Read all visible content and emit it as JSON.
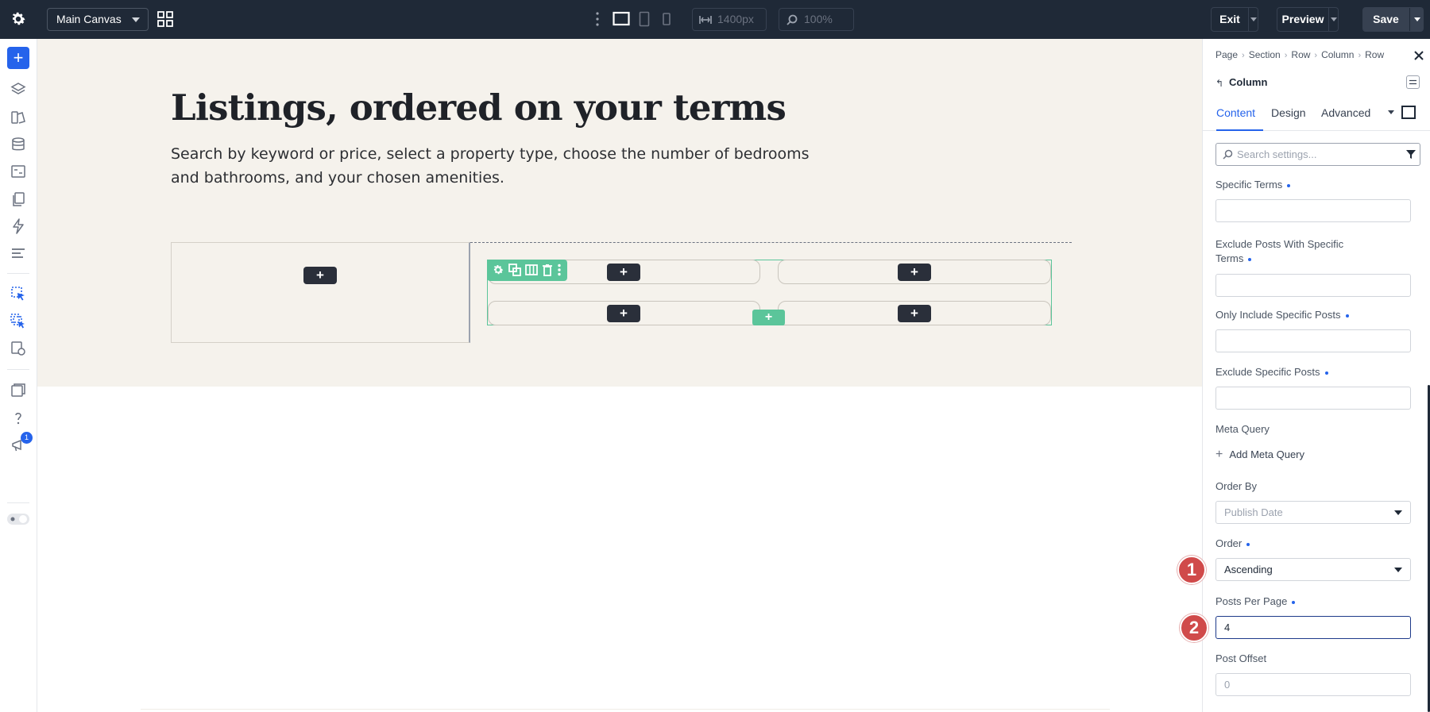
{
  "topbar": {
    "canvas_name": "Main Canvas",
    "width_value": "1400px",
    "zoom_value": "100%",
    "exit_label": "Exit",
    "preview_label": "Preview",
    "save_label": "Save"
  },
  "rail": {
    "notification_count": "1"
  },
  "canvas": {
    "title": "Listings, ordered on your terms",
    "description": "Search by keyword or price, select a property type, choose the number of bedrooms and bathrooms, and your chosen amenities.",
    "plus": "+"
  },
  "panel": {
    "breadcrumbs": [
      "Page",
      "Section",
      "Row",
      "Column",
      "Row"
    ],
    "heading": "Column",
    "tabs": [
      "Content",
      "Design",
      "Advanced"
    ],
    "search_placeholder": "Search settings...",
    "fields": {
      "specific_terms_label": "Specific Terms",
      "exclude_terms_label": "Exclude Posts With Specific Terms",
      "only_include_label": "Only Include Specific Posts",
      "exclude_posts_label": "Exclude Specific Posts",
      "meta_query_label": "Meta Query",
      "add_meta_query": "Add Meta Query",
      "order_by_label": "Order By",
      "order_by_value": "Publish Date",
      "order_label": "Order",
      "order_value": "Ascending",
      "posts_per_page_label": "Posts Per Page",
      "posts_per_page_value": "4",
      "post_offset_label": "Post Offset",
      "post_offset_placeholder": "0"
    }
  },
  "markers": [
    "1",
    "2"
  ],
  "colors": {
    "topbar": "#1f2937",
    "accent": "#2563eb",
    "hero_bg": "#f5f2ec",
    "row_outline": "#5bc59a",
    "marker": "#d04a4a"
  }
}
